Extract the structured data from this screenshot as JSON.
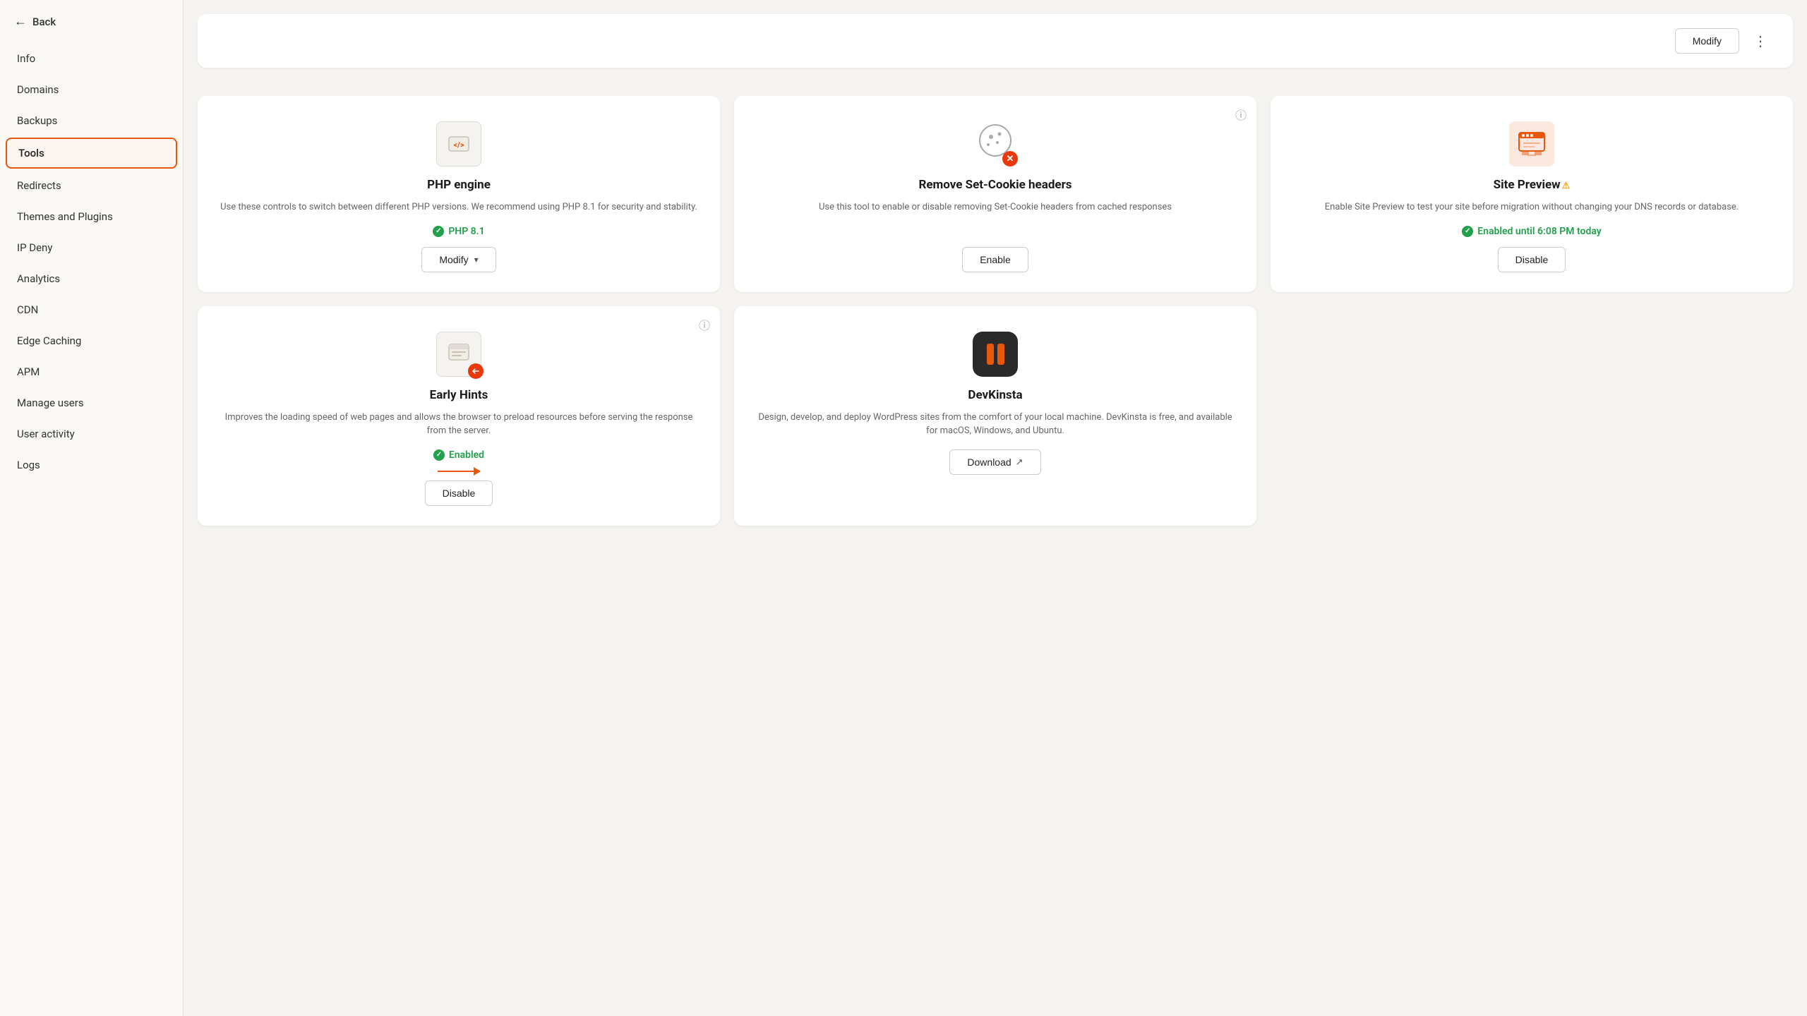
{
  "sidebar": {
    "back_label": "Back",
    "items": [
      {
        "id": "info",
        "label": "Info",
        "active": false
      },
      {
        "id": "domains",
        "label": "Domains",
        "active": false
      },
      {
        "id": "backups",
        "label": "Backups",
        "active": false
      },
      {
        "id": "tools",
        "label": "Tools",
        "active": true
      },
      {
        "id": "redirects",
        "label": "Redirects",
        "active": false
      },
      {
        "id": "themes-plugins",
        "label": "Themes and Plugins",
        "active": false
      },
      {
        "id": "ip-deny",
        "label": "IP Deny",
        "active": false
      },
      {
        "id": "analytics",
        "label": "Analytics",
        "active": false
      },
      {
        "id": "cdn",
        "label": "CDN",
        "active": false
      },
      {
        "id": "edge-caching",
        "label": "Edge Caching",
        "active": false
      },
      {
        "id": "apm",
        "label": "APM",
        "active": false
      },
      {
        "id": "manage-users",
        "label": "Manage users",
        "active": false
      },
      {
        "id": "user-activity",
        "label": "User activity",
        "active": false
      },
      {
        "id": "logs",
        "label": "Logs",
        "active": false
      }
    ]
  },
  "top_card": {
    "modify_label": "Modify",
    "more_label": "⋮"
  },
  "php_card": {
    "title": "PHP engine",
    "description": "Use these controls to switch between different PHP versions. We recommend using PHP 8.1 for security and stability.",
    "status": "PHP 8.1",
    "modify_label": "Modify"
  },
  "cookie_card": {
    "title": "Remove Set-Cookie headers",
    "description": "Use this tool to enable or disable removing Set-Cookie headers from cached responses",
    "enable_label": "Enable",
    "info_icon": "ⓘ"
  },
  "site_preview_card": {
    "title": "Site Preview",
    "warning": "⚠",
    "description": "Enable Site Preview to test your site before migration without changing your DNS records or database.",
    "status": "Enabled until 6:08 PM today",
    "disable_label": "Disable",
    "info_icon": ""
  },
  "early_hints_card": {
    "title": "Early Hints",
    "description": "Improves the loading speed of web pages and allows the browser to preload resources before serving the response from the server.",
    "status": "Enabled",
    "disable_label": "Disable",
    "info_icon": "ⓘ"
  },
  "devkinsta_card": {
    "title": "DevKinsta",
    "description": "Design, develop, and deploy WordPress sites from the comfort of your local machine. DevKinsta is free, and available for macOS, Windows, and Ubuntu.",
    "download_label": "Download"
  }
}
